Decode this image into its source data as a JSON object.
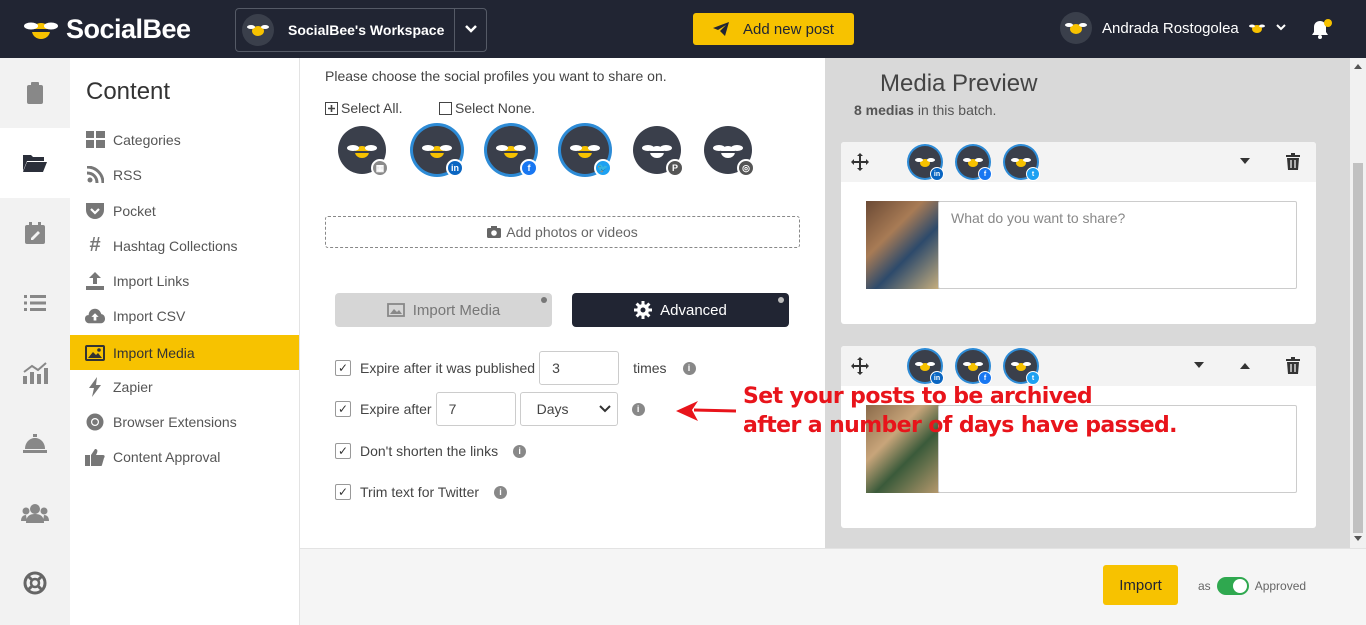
{
  "app": {
    "name": "SocialBee"
  },
  "workspace": {
    "name": "SocialBee's Workspace"
  },
  "header": {
    "add_post_label": "Add new post",
    "user_name": "Andrada Rostogolea"
  },
  "sidebar": {
    "title": "Content",
    "items": [
      {
        "label": "Categories",
        "icon": "grid-icon"
      },
      {
        "label": "RSS",
        "icon": "rss-icon"
      },
      {
        "label": "Pocket",
        "icon": "pocket-icon"
      },
      {
        "label": "Hashtag Collections",
        "icon": "hashtag-icon"
      },
      {
        "label": "Import Links",
        "icon": "upload-icon"
      },
      {
        "label": "Import CSV",
        "icon": "cloud-upload-icon"
      },
      {
        "label": "Import Media",
        "icon": "image-icon",
        "active": true
      },
      {
        "label": "Zapier",
        "icon": "bolt-icon"
      },
      {
        "label": "Browser Extensions",
        "icon": "chrome-icon"
      },
      {
        "label": "Content Approval",
        "icon": "thumbs-up-icon"
      }
    ]
  },
  "main": {
    "prompt": "Please choose the social profiles you want to share on.",
    "select_all": "Select All.",
    "select_none": "Select None.",
    "profiles": [
      {
        "network": "google-business",
        "selected": false,
        "badge_color": "#8a8a8a"
      },
      {
        "network": "linkedin",
        "selected": true,
        "badge_color": "#0a66c2"
      },
      {
        "network": "facebook",
        "selected": true,
        "badge_color": "#1877f2"
      },
      {
        "network": "twitter",
        "selected": true,
        "badge_color": "#1da1f2"
      },
      {
        "network": "pinterest",
        "selected": false,
        "badge_color": "#555555"
      },
      {
        "network": "instagram",
        "selected": false,
        "badge_color": "#555555"
      }
    ],
    "add_media": "Add photos or videos",
    "tabs": {
      "import_media": "Import Media",
      "advanced": "Advanced"
    },
    "options": {
      "expire_published_label": "Expire after it was published",
      "expire_published_value": "3",
      "times_label": "times",
      "expire_after_label": "Expire after",
      "expire_after_value": "7",
      "expire_unit": "Days",
      "dont_shorten": "Don't shorten the links",
      "trim_twitter": "Trim text for Twitter"
    }
  },
  "preview": {
    "title": "Media Preview",
    "count_bold": "8 medias",
    "count_rest": " in this batch.",
    "placeholder": "What do you want to share?"
  },
  "footer": {
    "import_label": "Import",
    "as_label": "as",
    "approved_label": "Approved"
  },
  "annotation": {
    "line1": "Set your posts to be archived",
    "line2": "after a number of days have passed."
  },
  "colors": {
    "brand_yellow": "#f7c200",
    "dark": "#212533",
    "annotation_red": "#e8141b"
  }
}
